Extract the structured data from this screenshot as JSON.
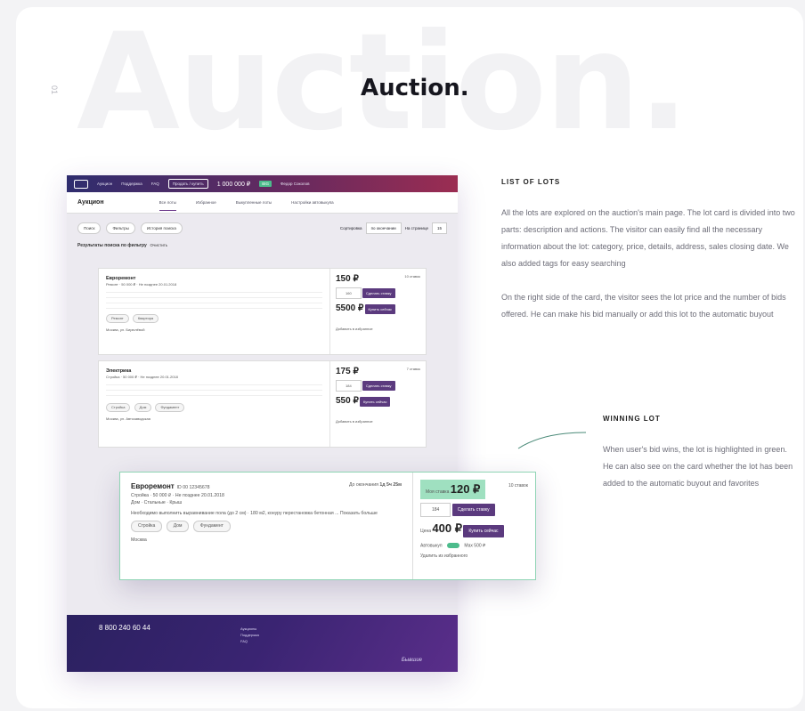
{
  "page": {
    "bg_word": "Auction.",
    "title": "Auction.",
    "section_number": "01"
  },
  "screen": {
    "topbar": {
      "menu_auctions": "Аукцион",
      "menu_support": "Поддержка",
      "menu_faq": "FAQ",
      "btn_post": "Продать / купить",
      "balance": "1 000 000 ₽",
      "tag": "BIG",
      "user": "Федор Соколов"
    },
    "subnav": {
      "heading": "Аукцион",
      "tab_all": "Все лоты",
      "tab_fav": "Избранное",
      "tab_auto": "Выкупленные лоты",
      "tab_settings": "Настройки автовыкупа"
    },
    "toolbar": {
      "search": "Поиск",
      "filters": "Фильтры",
      "history": "История поиска",
      "sort_label": "Сортировка",
      "sort_value": "по окончании",
      "per_page_label": "На странице",
      "per_page_value": "15"
    },
    "results": {
      "text": "Результаты поиска по фильтру",
      "reset": "Очистить"
    },
    "lots": [
      {
        "name": "Евроремонт",
        "sub": "Ремонт · 50 000 ₽ · Не позднее 20.01.2018",
        "tags": [
          "Ремонт",
          "Квартира"
        ],
        "place": "Москва, ул. Бирюлёвой",
        "timer": "1д 5ч 25м",
        "current_price": "150 ₽",
        "bids": "10 ставок",
        "bid_input": "160",
        "bid_btn": "Сделать ставку",
        "buy_price": "5500 ₽",
        "buy_btn": "Купить сейчас",
        "fav": "Добавить в избранное"
      },
      {
        "name": "Электрика",
        "sub": "Стройка · 50 000 ₽ · Не позднее 20.01.2018",
        "tags": [
          "Стройка",
          "Дом",
          "Фундамент"
        ],
        "place": "Москва, ул. Автозаводская",
        "timer": "1д 5ч 25м",
        "current_price": "175 ₽",
        "bids": "7 ставок",
        "bid_input": "184",
        "bid_btn": "Сделать ставку",
        "buy_price": "550 ₽",
        "buy_btn": "Купить сейчас",
        "fav": "Добавить в избранное"
      }
    ],
    "footer": {
      "phone": "8 800 240 60 44",
      "link1": "Аукционы",
      "link2": "Поддержка",
      "link3": "FAQ",
      "brand": "Бывшие"
    }
  },
  "winning_card": {
    "name": "Евроремонт",
    "id": "ID 00 12345678",
    "sub": "Стройка · 50 000 ₽ · Не позднее 20.01.2018",
    "cats": "Дом · Стальные · Крыш",
    "text": "Необходимо выполнить выравнивание пола (до 2 см) · 180 м2, конуру перестановка бетонная ... Показать больше",
    "show_more": "Показать больше",
    "tags": [
      "Стройка",
      "Дом",
      "Фундамент"
    ],
    "place": "Москва",
    "timer_label": "До окончания",
    "timer": "1д 5ч 25м",
    "current_label": "Моя ставка",
    "current_price": "120 ₽",
    "bids": "10 ставок",
    "bid_input": "184",
    "bid_btn": "Сделать ставку",
    "buy_label": "Цена",
    "buy_price": "400 ₽",
    "buy_btn": "Купить сейчас",
    "auto_label": "Автовыкуп",
    "auto_max": "Мах 500 ₽",
    "fav": "Удалить из избранного"
  },
  "list_of_lots": {
    "heading": "LIST OF LOTS",
    "p1": "All the lots are explored on the auction's main page. The lot card is divided into two parts: description and actions. The visitor can easily find all the necessary information about the lot: category, price, details, address, sales closing date. We also added tags for easy searching",
    "p2": "On the right side of the card, the visitor sees the lot price and the number of bids offered. He can make his bid manually or add this lot to the automatic buyout"
  },
  "winning_lot": {
    "heading": "WINNING LOT",
    "p1": "When user's bid wins, the lot is highlighted in green. He can also see on the card whether the lot has been added to the automatic buyout and favorites"
  },
  "colors": {
    "accent": "#5b3a7e",
    "win": "#9fe0c0",
    "topbar_from": "#2f2d6e",
    "topbar_to": "#9b2d52"
  }
}
